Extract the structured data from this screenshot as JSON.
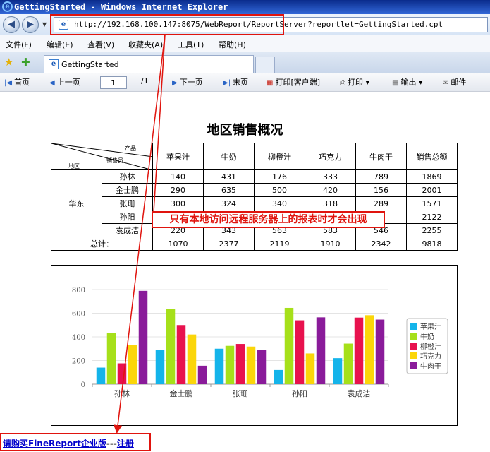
{
  "window": {
    "title": "GettingStarted - Windows Internet Explorer"
  },
  "address": {
    "url": "http://192.168.100.147:8075/WebReport/ReportServer?reportlet=GettingStarted.cpt"
  },
  "menu": [
    "文件(F)",
    "编辑(E)",
    "查看(V)",
    "收藏夹(A)",
    "工具(T)",
    "帮助(H)"
  ],
  "tab": {
    "title": "GettingStarted"
  },
  "toolbar": {
    "first": "首页",
    "prev": "上一页",
    "page": "1",
    "total": "/1",
    "next": "下一页",
    "last": "末页",
    "print_client": "打印[客户端]",
    "print": "打印",
    "export": "输出",
    "mail": "邮件"
  },
  "report": {
    "title": "地区销售概况",
    "header": {
      "product": "产品",
      "salesperson": "销售员",
      "region": "地区"
    },
    "columns": [
      "苹果汁",
      "牛奶",
      "柳橙汁",
      "巧克力",
      "牛肉干",
      "销售总额"
    ],
    "region": "华东",
    "rows": [
      {
        "name": "孙林",
        "values": [
          "140",
          "431",
          "176",
          "333",
          "789",
          "1869"
        ]
      },
      {
        "name": "金士鹏",
        "values": [
          "290",
          "635",
          "500",
          "420",
          "156",
          "2001"
        ]
      },
      {
        "name": "张珊",
        "values": [
          "300",
          "324",
          "340",
          "318",
          "289",
          "1571"
        ]
      },
      {
        "name": "孙阳",
        "values": [
          "",
          "",
          "",
          "",
          "",
          "2122"
        ]
      },
      {
        "name": "袁成洁",
        "values": [
          "220",
          "343",
          "563",
          "583",
          "546",
          "2255"
        ]
      }
    ],
    "total_label": "总计：",
    "totals": [
      "1070",
      "2377",
      "2119",
      "1910",
      "2342",
      "9818"
    ]
  },
  "chart_data": {
    "type": "bar",
    "categories": [
      "孙林",
      "金士鹏",
      "张珊",
      "孙阳",
      "袁成洁"
    ],
    "series": [
      {
        "name": "苹果汁",
        "color": "#14b4ea",
        "values": [
          140,
          290,
          300,
          120,
          220
        ]
      },
      {
        "name": "牛奶",
        "color": "#a6e01a",
        "values": [
          431,
          635,
          324,
          645,
          343
        ]
      },
      {
        "name": "柳橙汁",
        "color": "#e8124e",
        "values": [
          176,
          500,
          340,
          540,
          563
        ]
      },
      {
        "name": "巧克力",
        "color": "#fbd60a",
        "values": [
          333,
          420,
          318,
          260,
          583
        ]
      },
      {
        "name": "牛肉干",
        "color": "#8a1b9a",
        "values": [
          789,
          156,
          289,
          565,
          546
        ]
      }
    ],
    "ylim": [
      0,
      800
    ],
    "yticks": [
      0,
      200,
      400,
      600,
      800
    ],
    "legend": "right",
    "grid": true
  },
  "annotations": {
    "callout": "只有本地访问远程服务器上的报表时才会出现",
    "buy_text": "请购买FineReport企业版",
    "buy_sep": "---",
    "buy_link": "注册"
  }
}
